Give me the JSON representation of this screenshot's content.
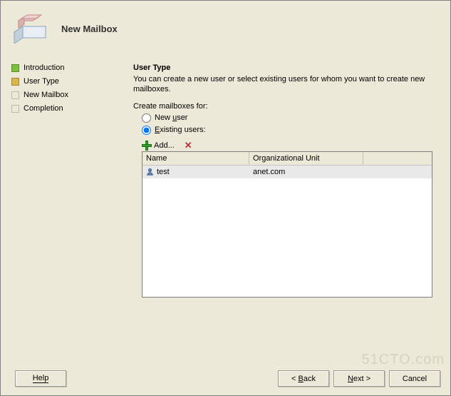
{
  "header": {
    "title": "New Mailbox"
  },
  "sidebar": {
    "items": [
      {
        "label": "Introduction",
        "state": "green"
      },
      {
        "label": "User Type",
        "state": "yellow"
      },
      {
        "label": "New Mailbox",
        "state": "grey"
      },
      {
        "label": "Completion",
        "state": "grey"
      }
    ]
  },
  "main": {
    "heading": "User Type",
    "description": "You can create a new user or select existing users for whom you want to create new mailboxes.",
    "create_label": "Create mailboxes for:",
    "radio_new_pre": "New ",
    "radio_new_u": "u",
    "radio_new_post": "ser",
    "radio_existing_u": "E",
    "radio_existing_post": "xisting users:",
    "selected": "existing",
    "toolbar": {
      "add_u": "A",
      "add_post": "dd...",
      "remove": "✕"
    },
    "table": {
      "columns": [
        "Name",
        "Organizational Unit"
      ],
      "rows": [
        {
          "name": "test",
          "ou": "anet.com"
        }
      ]
    }
  },
  "footer": {
    "help": "Help",
    "back_pre": "< ",
    "back_u": "B",
    "back_post": "ack",
    "next_u": "N",
    "next_post": "ext >",
    "cancel": "Cancel"
  },
  "watermark": "51CTO.com"
}
